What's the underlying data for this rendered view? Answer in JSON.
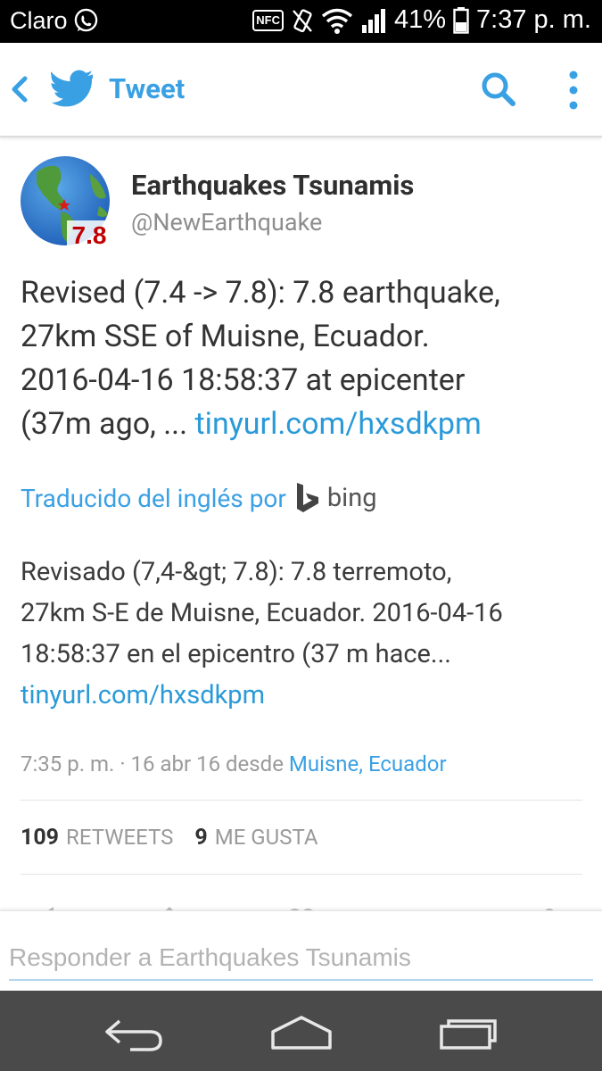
{
  "status_bar": {
    "carrier": "Claro",
    "nfc": "NFC",
    "battery": "41%",
    "time": "7:37 p. m."
  },
  "app_bar": {
    "title": "Tweet"
  },
  "tweet": {
    "avatar_label": "7.8",
    "author_name": "Earthquakes Tsunamis",
    "author_handle": "@NewEarthquake",
    "text_lines": [
      "Revised (7.4 -> 7.8): 7.8 earthquake,",
      "27km SSE of Muisne, Ecuador.",
      "2016-04-16 18:58:37 at epicenter",
      "(37m ago, ... "
    ],
    "link": "tinyurl.com/hxsdkpm",
    "translated_by": "Traducido del inglés por",
    "translator": "bing",
    "translation_lines": [
      "Revisado (7,4-&gt; 7.8): 7.8 terremoto,",
      "27km S-E de Muisne, Ecuador. 2016-04-16",
      "18:58:37 en el epicentro (37 m hace..."
    ],
    "translation_link": "tinyurl.com/hxsdkpm",
    "timestamp": "7:35 p. m. · 16 abr 16",
    "from_label": "desde",
    "location": "Muisne, Ecuador",
    "retweets_count": "109",
    "retweets_label": "RETWEETS",
    "likes_count": "9",
    "likes_label": "ME GUSTA"
  },
  "reply": {
    "placeholder": "Responder a Earthquakes Tsunamis"
  },
  "colors": {
    "twitter_blue": "#3aa0e4",
    "link_blue": "#2a9ad8",
    "nav_bar": "#4a4a4a",
    "magnitude_red": "#c00000"
  }
}
